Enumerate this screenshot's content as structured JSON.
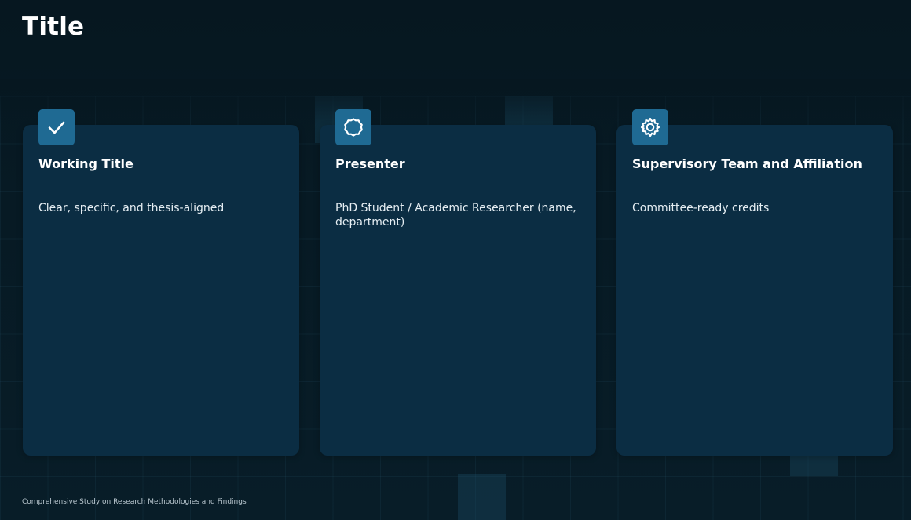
{
  "slide": {
    "title": "Title",
    "footer": "Comprehensive Study on Research Methodologies and Findings"
  },
  "cards": [
    {
      "icon": "checkmark-icon",
      "title": "Working Title",
      "description": "Clear, specific, and thesis-aligned"
    },
    {
      "icon": "badge-outline-icon",
      "title": "Presenter",
      "description": "PhD Student / Academic Researcher (name, department)"
    },
    {
      "icon": "gear-icon",
      "title": "Supervisory Team and Affiliation",
      "description": "Committee-ready credits"
    }
  ],
  "colors": {
    "background": "#061720",
    "card": "#0b2d43",
    "icon_tile": "#1f6a93",
    "text": "#ffffff"
  }
}
